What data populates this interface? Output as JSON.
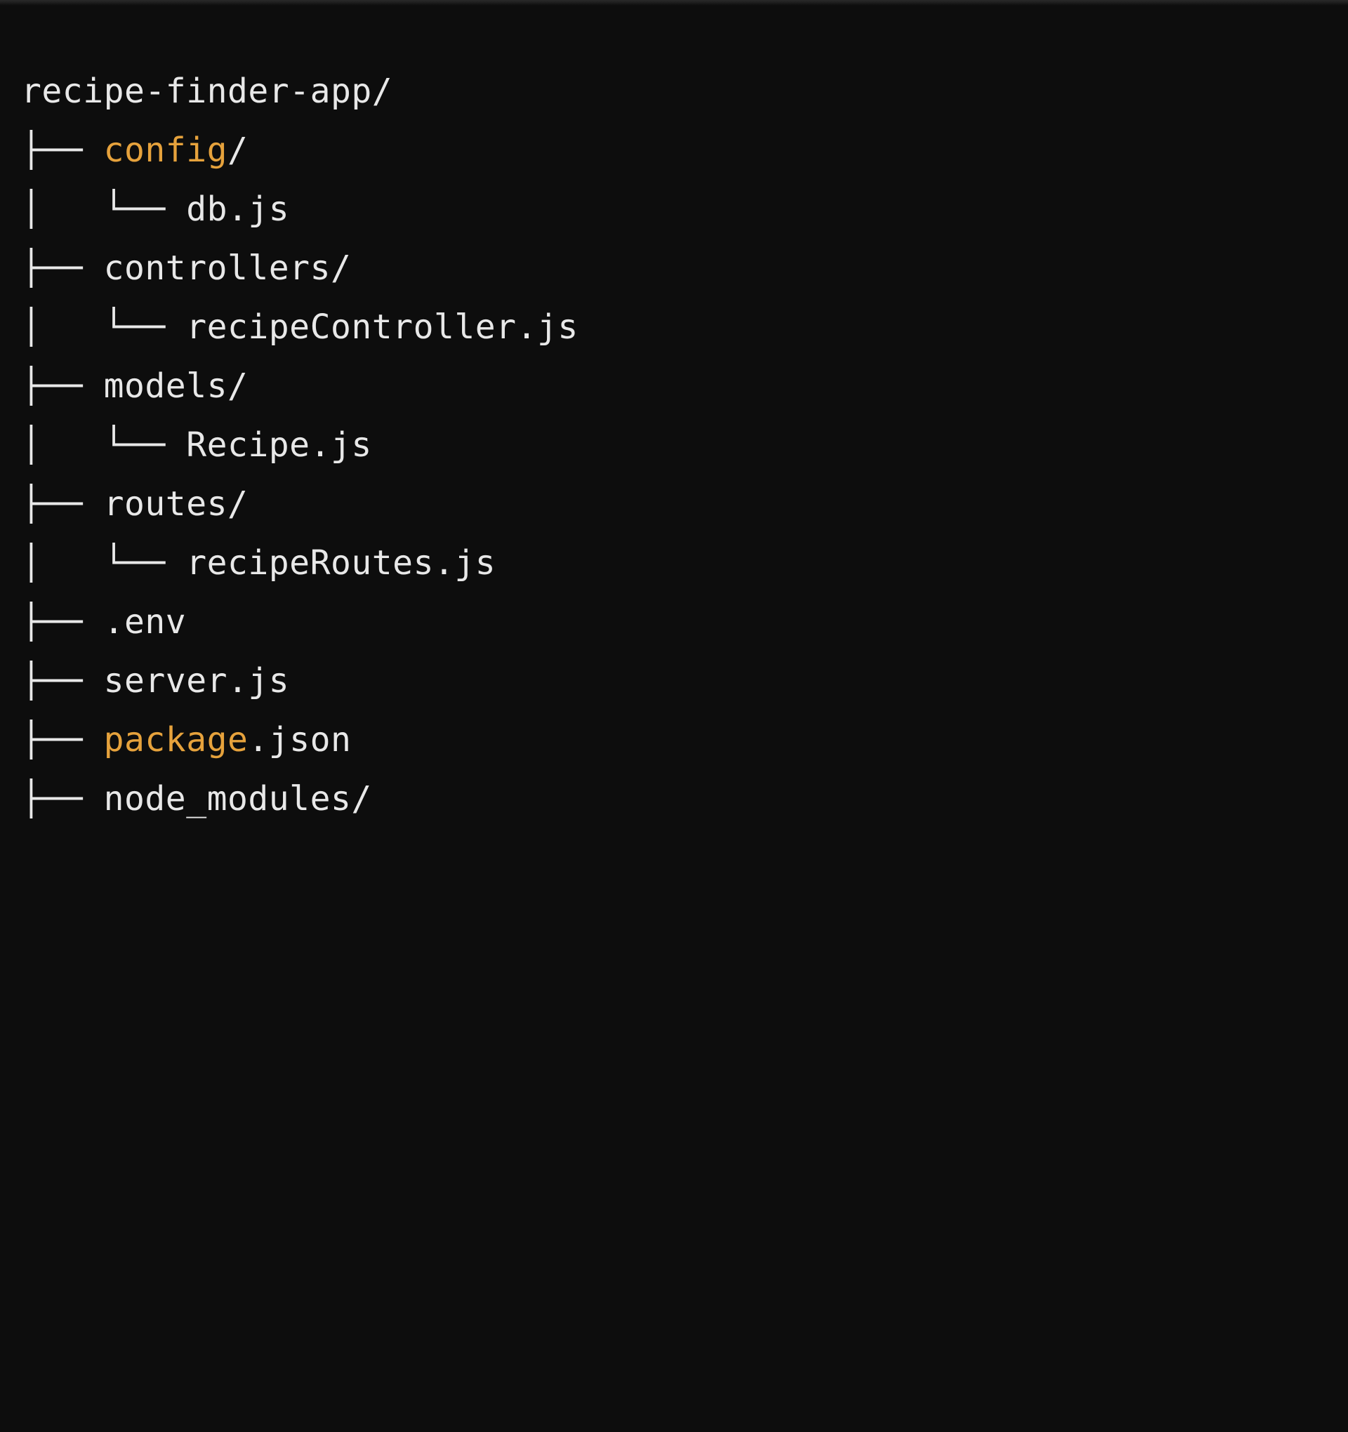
{
  "tree": {
    "root": "recipe-finder-app/",
    "lines": [
      {
        "prefix": "├── ",
        "highlight": "config",
        "suffix": "/"
      },
      {
        "prefix": "│   └── db.js",
        "highlight": "",
        "suffix": ""
      },
      {
        "prefix": "├── controllers/",
        "highlight": "",
        "suffix": ""
      },
      {
        "prefix": "│   └── recipeController.js",
        "highlight": "",
        "suffix": ""
      },
      {
        "prefix": "├── models/",
        "highlight": "",
        "suffix": ""
      },
      {
        "prefix": "│   └── Recipe.js",
        "highlight": "",
        "suffix": ""
      },
      {
        "prefix": "├── routes/",
        "highlight": "",
        "suffix": ""
      },
      {
        "prefix": "│   └── recipeRoutes.js",
        "highlight": "",
        "suffix": ""
      },
      {
        "prefix": "├── .env",
        "highlight": "",
        "suffix": ""
      },
      {
        "prefix": "├── server.js",
        "highlight": "",
        "suffix": ""
      },
      {
        "prefix": "├── ",
        "highlight": "package",
        "suffix": ".json"
      },
      {
        "prefix": "├── node_modules/",
        "highlight": "",
        "suffix": ""
      }
    ]
  }
}
